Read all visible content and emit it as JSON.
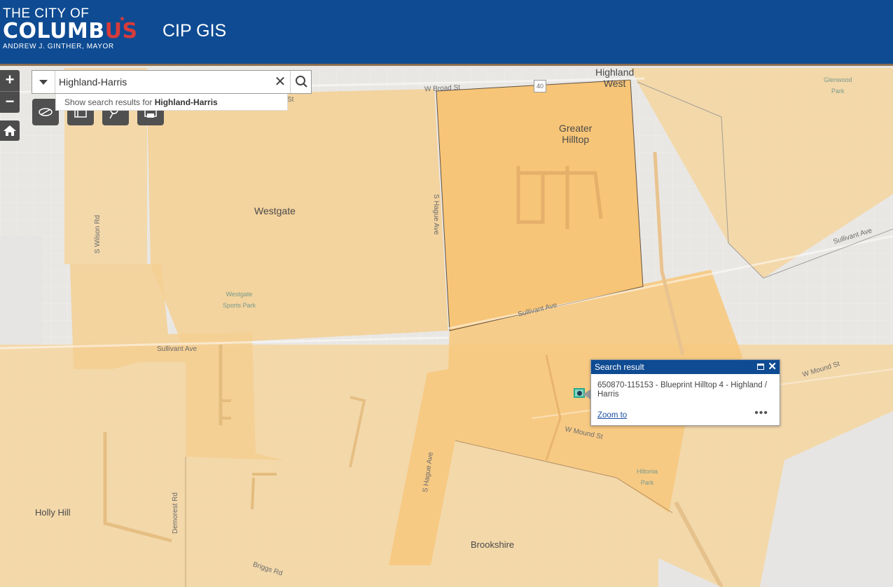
{
  "header": {
    "logo_line1": "THE CITY OF",
    "logo_line2a": "COLUMB",
    "logo_line2b": "US",
    "logo_line3": "ANDREW J. GINTHER, MAYOR",
    "app_title": "CIP GIS",
    "colors": {
      "bar": "#0e4b92",
      "accent_red": "#d73b3b"
    }
  },
  "controls": {
    "zoom_in": "+",
    "zoom_out": "−",
    "home_icon": "home-icon",
    "tools": [
      "measure-icon",
      "layers-icon",
      "legend-icon",
      "print-icon"
    ]
  },
  "search": {
    "value": "Highland-Harris",
    "clear": "✕",
    "suggestion_prefix": "Show search results for ",
    "suggestion_term": "Highland-Harris"
  },
  "popup": {
    "title": "Search result",
    "content": "650870-115153 - Blueprint Hilltop 4 - Highland / Harris",
    "zoom_link": "Zoom to",
    "more": "•••"
  },
  "map_labels": {
    "highland_west": "Highland\nWest",
    "greater_hilltop": "Greater\nHilltop",
    "westgate": "Westgate",
    "westgate_park": "Westgate\nSports Park",
    "glenwood_park": "Glenwood\nPark",
    "w_broad": "W Broad St",
    "route_40": "40",
    "s_wilson": "S Wilson Rd",
    "s_hague_n": "S Hague Ave",
    "s_hague_s": "S Hague Ave",
    "sullivant_w": "Sullivant Ave",
    "sullivant_c": "Sullivant Ave",
    "sullivant_e": "Sullivant Ave",
    "w_mound_c": "W Mound St",
    "w_mound_e": "W Mound St",
    "hiltonia_park": "Hiltonia\nPark",
    "holly_hill": "Holly Hill",
    "demorest": "Demorest Rd",
    "brookshire": "Brookshire",
    "briggs": "Briggs Rd",
    "st_fragment": "St"
  },
  "colors": {
    "project_light": "#f5dcae",
    "project_mid": "#f6cf8c",
    "project_dark": "#f8c572",
    "base": "#ebe9e6"
  }
}
